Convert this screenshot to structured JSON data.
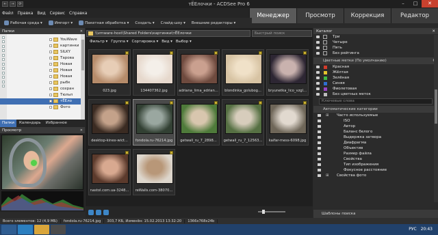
{
  "window": {
    "title": "тЁЕлочки - ACDSee Pro 6",
    "tb_icons": [
      "←",
      "→",
      "⟳"
    ],
    "min": "–",
    "max": "□",
    "close": "✕"
  },
  "menubar": [
    "Файл",
    "Правка",
    "Вид",
    "Сервис",
    "Справка"
  ],
  "modes": [
    {
      "label": "Менеджер",
      "active": true
    },
    {
      "label": "Просмотр",
      "active": false
    },
    {
      "label": "Коррекция",
      "active": false
    },
    {
      "label": "Редактор",
      "active": false
    }
  ],
  "toolbar": [
    "Рабочая среда ▾",
    "Импорт ▾",
    "Пакетная обработка ▾",
    "Создать ▾",
    "Слайд-шоу ▾",
    "Внешние редакторы ▾"
  ],
  "folders": {
    "title": "Папки",
    "close": "✕",
    "items": [
      {
        "label": "YouWave",
        "selected": false
      },
      {
        "label": "картинки",
        "selected": false
      },
      {
        "label": "SILKY",
        "selected": false
      },
      {
        "label": "Тарова",
        "selected": false
      },
      {
        "label": "Новая",
        "selected": false
      },
      {
        "label": "Новая",
        "selected": false
      },
      {
        "label": "Новая",
        "selected": false
      },
      {
        "label": "рыбк",
        "selected": false
      },
      {
        "label": "сохран",
        "selected": false
      },
      {
        "label": "Тюльп",
        "selected": false
      },
      {
        "label": "тЁЕло",
        "selected": true
      },
      {
        "label": "Фото",
        "selected": false
      }
    ]
  },
  "left_tabs": [
    {
      "label": "Папки",
      "active": true
    },
    {
      "label": "Календарь",
      "active": false
    },
    {
      "label": "Избранное",
      "active": false
    }
  ],
  "preview": {
    "title": "Просмотр",
    "close": "✕"
  },
  "address": {
    "path": "\\\\vmware-host\\Shared Folders\\картинки\\тЁЕлочки",
    "placeholder": "Быстрый поиск"
  },
  "filterbar": [
    "Фильтр ▾",
    "Группа ▾",
    "Сортировка ▾",
    "Вид ▾",
    "Выбор ▾"
  ],
  "thumbnails": [
    {
      "caption": "023.jpg",
      "c1": "#b58b6a",
      "c2": "#e7cdb6",
      "selected": false
    },
    {
      "caption": "134407362.jpg",
      "c1": "#e6d8cc",
      "c2": "#f4efe9",
      "selected": false
    },
    {
      "caption": "adriana_lima_adrian...",
      "c1": "#6e4a3e",
      "c2": "#caa08f",
      "selected": false
    },
    {
      "caption": "blondinka_golubog...",
      "c1": "#d7c3a3",
      "c2": "#f0e1c8",
      "selected": false
    },
    {
      "caption": "bryunetka_lico_vzgl...",
      "c1": "#2d2633",
      "c2": "#c9b2ae",
      "selected": false
    },
    {
      "caption": "desktop-kinex-wict...",
      "c1": "#3a2b22",
      "c2": "#c4a28a",
      "selected": false
    },
    {
      "caption": "fondola.ru-76214.jpg",
      "c1": "#324033",
      "c2": "#9aa7a0",
      "selected": true
    },
    {
      "caption": "getwall_ru_7_2898...",
      "c1": "#4e7a3a",
      "c2": "#d8c6ae",
      "selected": false
    },
    {
      "caption": "getwall_ru_7_12563...",
      "c1": "#567043",
      "c2": "#d7cdbc",
      "selected": false
    },
    {
      "caption": "kaifar-mess-6098.jpg",
      "c1": "#6e6658",
      "c2": "#e1d9cf",
      "selected": false
    },
    {
      "caption": "nastol.com.ua-3248...",
      "c1": "#5b3a2c",
      "c2": "#d8a990",
      "selected": false
    },
    {
      "caption": "reWalls.com-38070...",
      "c1": "#ddd6cc",
      "c2": "#b89778",
      "selected": false
    }
  ],
  "catalog": {
    "title": "Каталог",
    "close": "✕",
    "ratings": [
      "Три",
      "Четыре",
      "Пять",
      "Без рейтинга"
    ],
    "color_labels_title": "Цветные метки (По умолчанию)",
    "color_labels": [
      {
        "label": "Красная",
        "color": "#d43b2b"
      },
      {
        "label": "Жёлтая",
        "color": "#e3c22c"
      },
      {
        "label": "Зелёная",
        "color": "#3fb845"
      },
      {
        "label": "Синяя",
        "color": "#2f6fd1"
      },
      {
        "label": "Фиолетовая",
        "color": "#9a44c4"
      },
      {
        "label": "Без цветных меток",
        "color": "#bdbdbd"
      }
    ],
    "keywords_placeholder": "Ключевые слова",
    "auto_title": "Автоматические категории",
    "auto_items": [
      {
        "label": "Часто используемые",
        "sub": false
      },
      {
        "label": "ISO",
        "sub": true
      },
      {
        "label": "Автор",
        "sub": true
      },
      {
        "label": "Баланс белого",
        "sub": true
      },
      {
        "label": "Выдержка затвора",
        "sub": true
      },
      {
        "label": "Диафрагма",
        "sub": true
      },
      {
        "label": "Объектив",
        "sub": true
      },
      {
        "label": "Размер файла",
        "sub": true
      },
      {
        "label": "Свойства",
        "sub": true
      },
      {
        "label": "Тип изображения",
        "sub": true
      },
      {
        "label": "Фокусное расстояние",
        "sub": true
      },
      {
        "label": "Свойства фото",
        "sub": false
      }
    ],
    "search_templates": "Шаблоны поиска",
    "gear": "⚙",
    "plus": "+"
  },
  "status": {
    "total": "Всего элементов: 12 (4,9 МБ)",
    "file": "fondola.ru-76214.jpg",
    "size": "303,7 КБ, Изменён: 15.02.2013 13:32:20",
    "dims": "1366x768x24b"
  },
  "taskbar": {
    "lang": "РУС",
    "time": "20:43"
  }
}
